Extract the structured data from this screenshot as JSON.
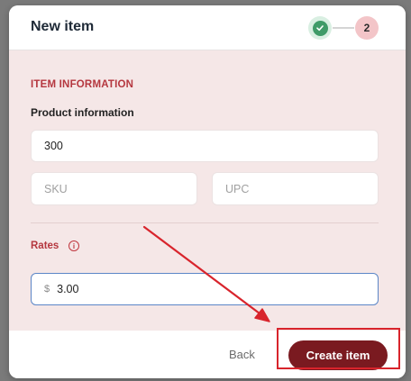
{
  "modal": {
    "title": "New item",
    "stepper": {
      "completed_step_icon": "check-icon",
      "current_step": "2"
    }
  },
  "form": {
    "section_title": "ITEM INFORMATION",
    "product_label": "Product information",
    "product_value": "300",
    "sku_placeholder": "SKU",
    "upc_placeholder": "UPC",
    "rates_label": "Rates",
    "rates_info_icon": "info-icon",
    "rate_prefix": "$",
    "rate_value": "3.00"
  },
  "footer": {
    "back_label": "Back",
    "create_label": "Create item"
  },
  "annotation": {
    "color": "#d8242c",
    "target": "create-item-button"
  },
  "colors": {
    "accent": "#7a1a20",
    "section_title": "#b5373f",
    "body_background": "#f5e7e7",
    "focus_border": "#5b86c7"
  }
}
